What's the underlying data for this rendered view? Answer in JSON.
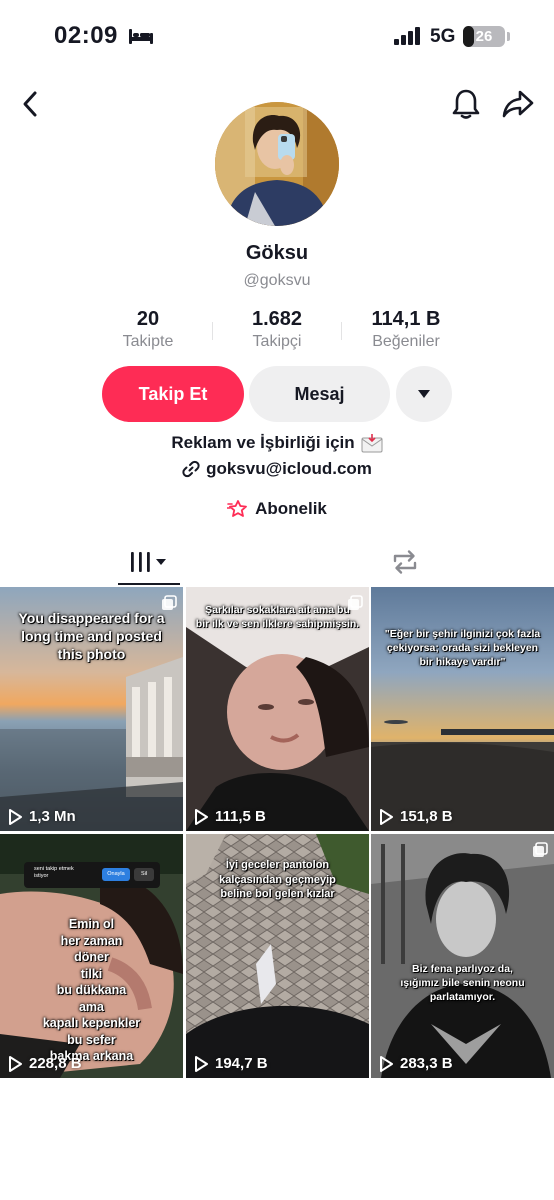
{
  "status_bar": {
    "time": "02:09",
    "network": "5G",
    "battery": "26",
    "battery_level": 0.26,
    "icons": [
      "bed-icon",
      "signal-icon"
    ]
  },
  "nav": {
    "icons": [
      "back-chevron-icon",
      "bell-icon",
      "share-arrow-icon"
    ]
  },
  "profile": {
    "name": "Göksu",
    "username": "@goksvu",
    "stats": [
      {
        "value": "20",
        "label": "Takipte"
      },
      {
        "value": "1.682",
        "label": "Takipçi"
      },
      {
        "value": "114,1 B",
        "label": "Beğeniler"
      }
    ],
    "follow_label": "Takip Et",
    "message_label": "Mesaj",
    "bio_line1": "Reklam ve İşbirliği için",
    "bio_email": "goksvu@icloud.com",
    "subscription_label": "Abonelik"
  },
  "colors": {
    "accent": "#fe2c55",
    "secondary_button": "#efeff0",
    "muted_text": "#8a8b91"
  },
  "tabs": [
    "videos-tab",
    "reposts-tab"
  ],
  "videos": [
    {
      "caption": "You disappeared for a\nlong time and posted\nthis photo",
      "views": "1,3 Mn"
    },
    {
      "caption": "Şarkılar sokaklara ait ama bu\nbir ilk ve sen ilklere sahipmişsin.",
      "views": "111,5 B"
    },
    {
      "caption": "\"Eğer bir şehir ilginizi çok fazla\nçekiyorsa; orada sizi bekleyen\nbir hikaye vardır\"",
      "views": "151,8 B"
    },
    {
      "caption": "Emin ol\nher zaman\ndöner\ntilki\nbu dükkana\nama\nkapalı kepenkler\nbu sefer\nbakma arkana",
      "views": "228,8 B",
      "overlay": {
        "text": "seni takip etmek\nistiyor",
        "confirm": "Onayla",
        "delete": "Sil"
      }
    },
    {
      "caption": "İyi geceler pantolon\nkalçasından geçmeyip\nbeline bol gelen kızlar",
      "views": "194,7 B"
    },
    {
      "caption": "Biz fena parlıyoz da,\nışığımız bile senin neonu\nparlatamıyor.",
      "views": "283,3 B"
    }
  ]
}
